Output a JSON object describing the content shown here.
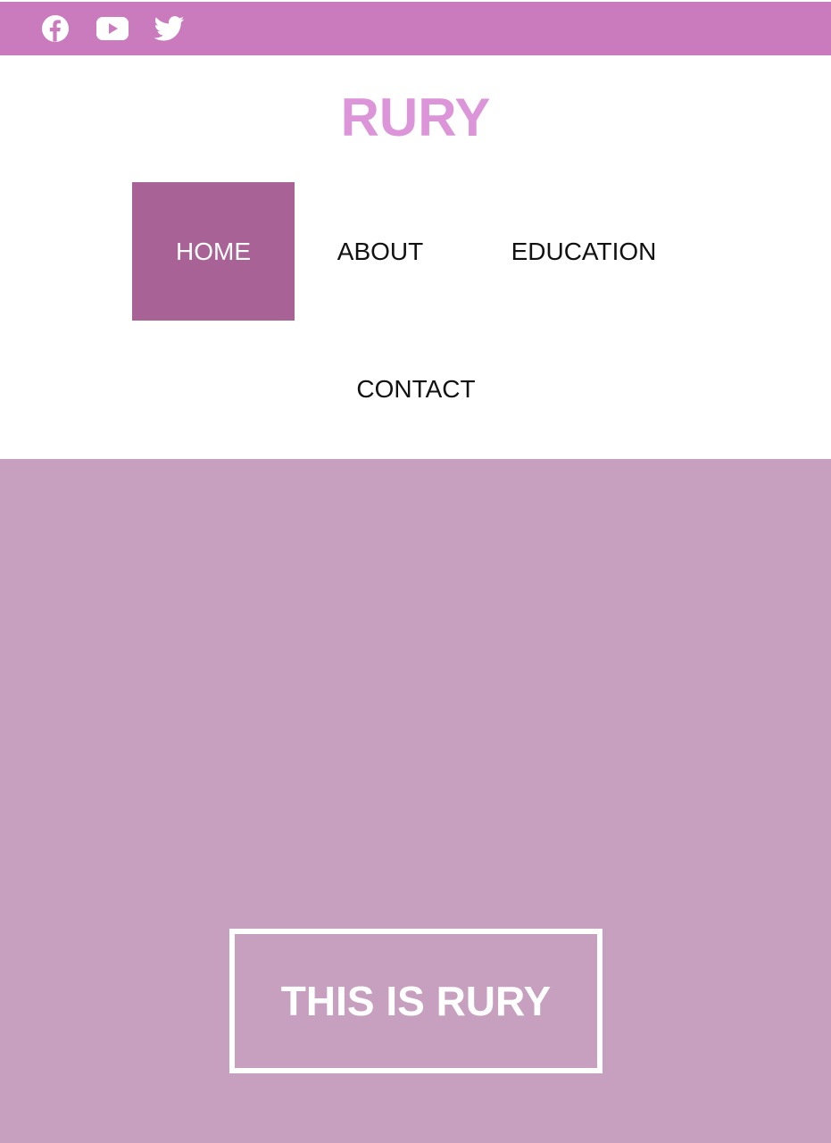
{
  "social": {
    "icons": [
      "facebook-icon",
      "youtube-icon",
      "twitter-icon"
    ],
    "bar_color": "#c97bbd"
  },
  "header": {
    "brand": "RURY",
    "brand_color": "#dd95d9"
  },
  "nav": {
    "items": [
      {
        "label": "HOME",
        "active": true
      },
      {
        "label": "ABOUT",
        "active": false
      },
      {
        "label": "EDUCATION",
        "active": false
      },
      {
        "label": "CONTACT",
        "active": false
      }
    ],
    "active_color": "#a96296"
  },
  "hero": {
    "title": "THIS IS RURY",
    "background": "#c6a0be"
  }
}
